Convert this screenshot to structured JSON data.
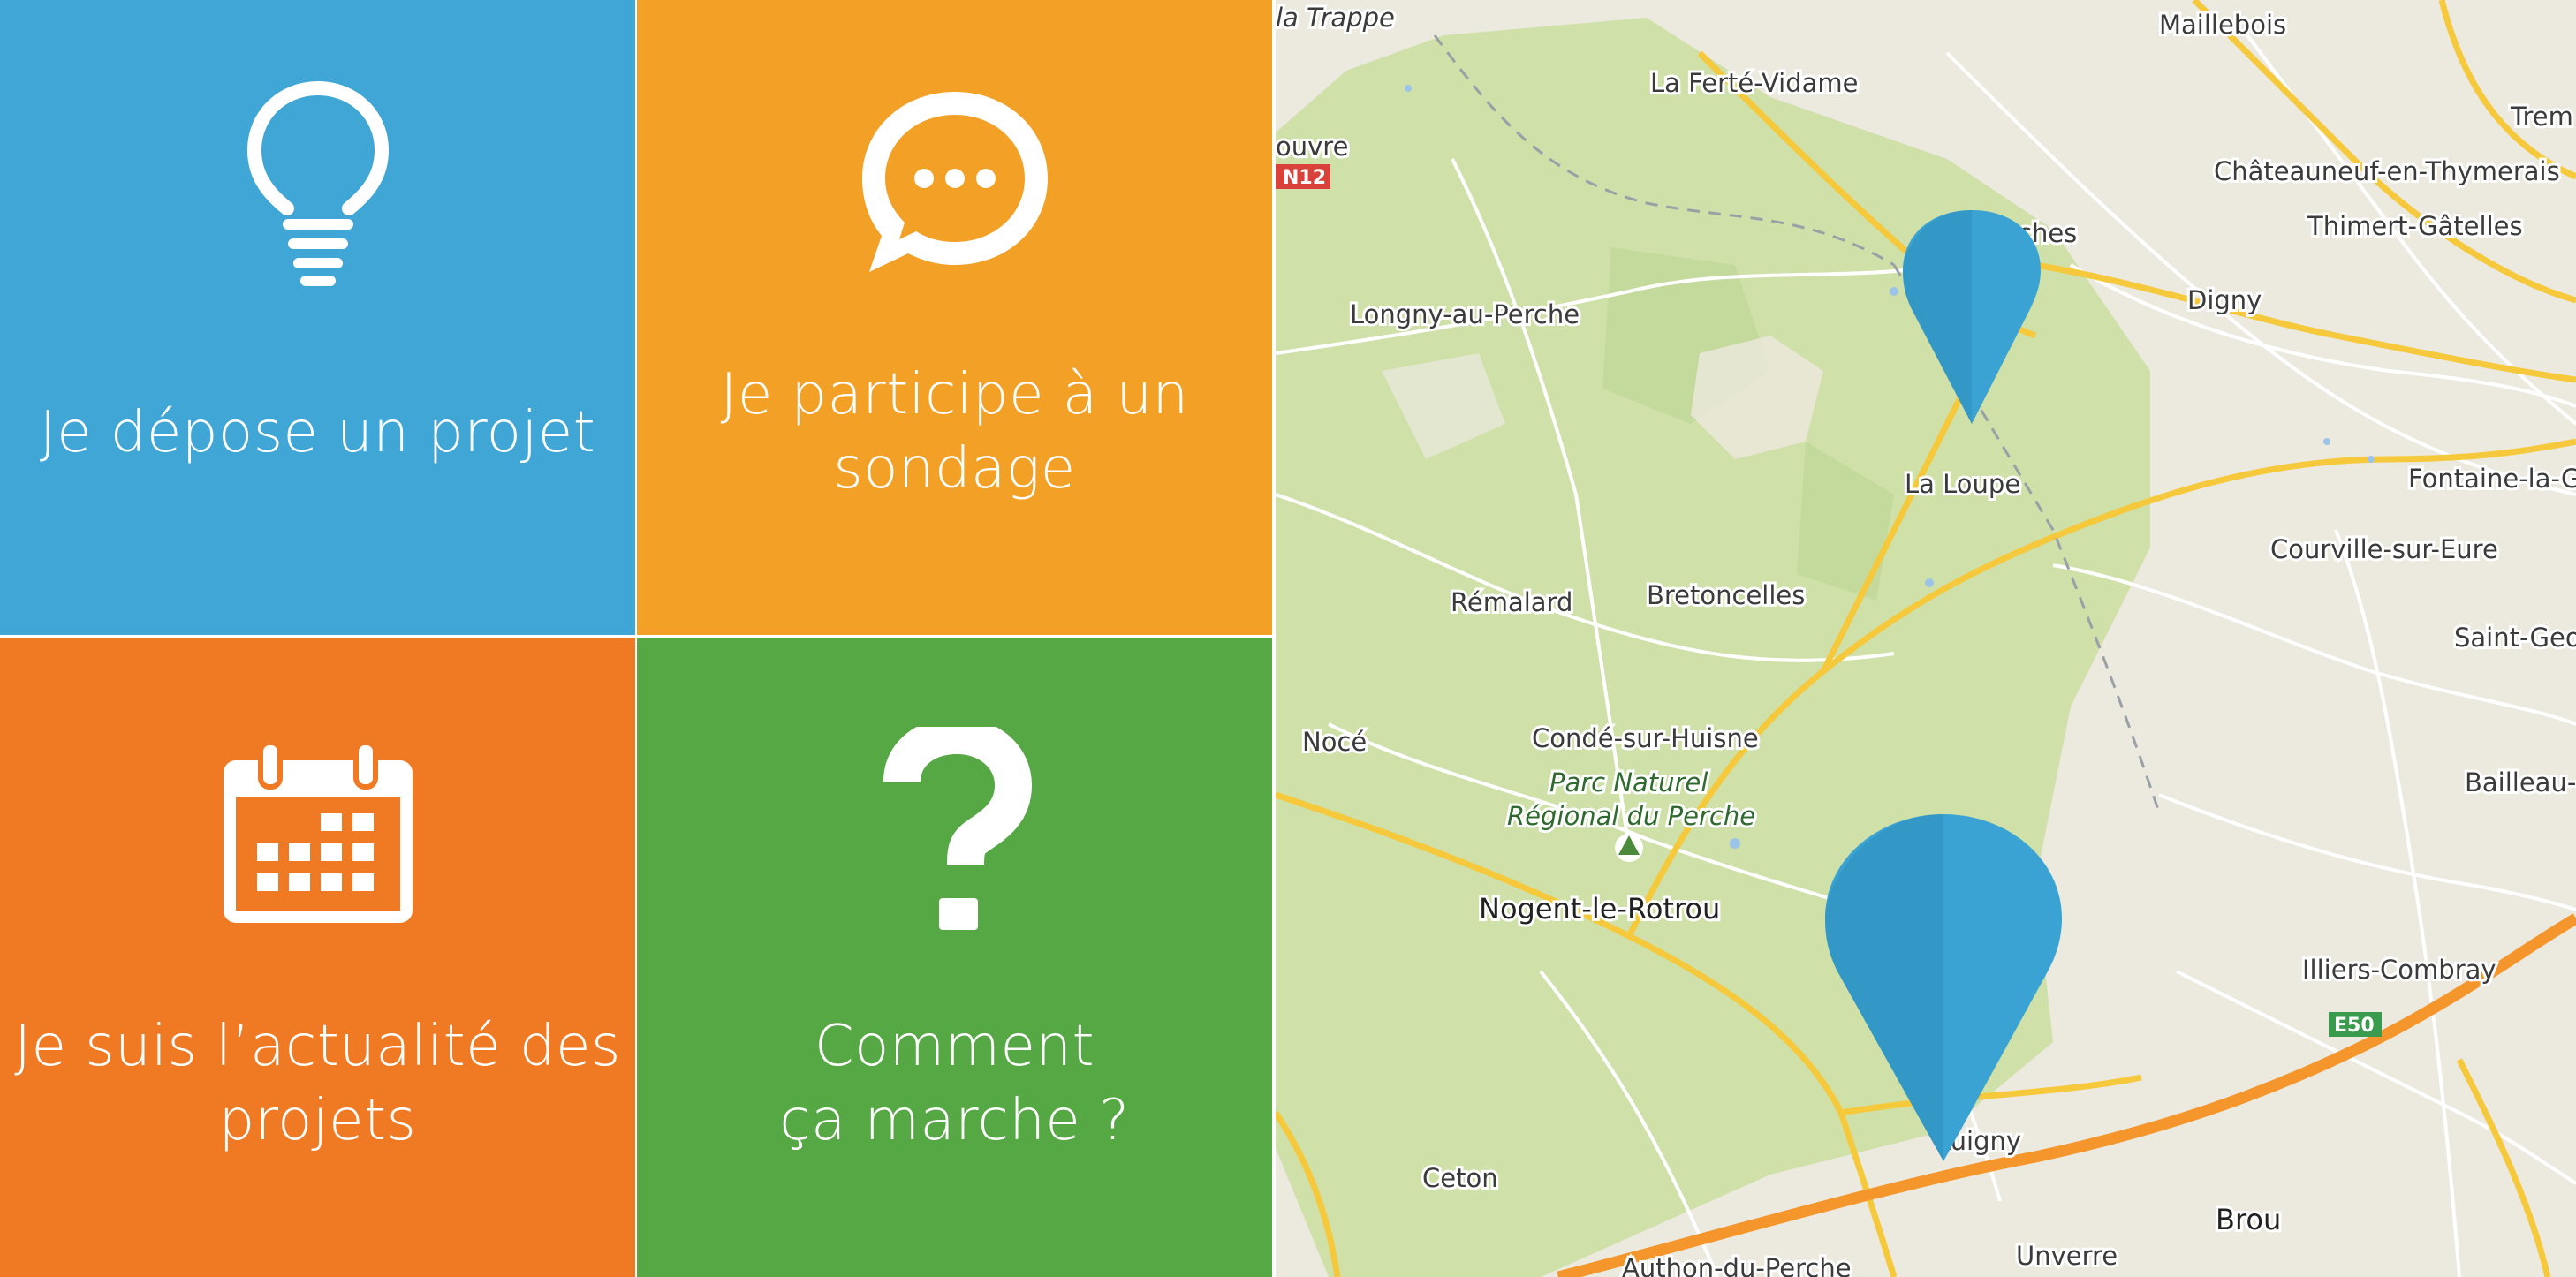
{
  "tiles": [
    {
      "label_line1": "Je dépose un projet",
      "label_line2": "",
      "icon": "lightbulb-icon",
      "color": "#3fa6d6"
    },
    {
      "label_line1": "Je participe à un",
      "label_line2": "sondage",
      "icon": "chat-bubble-icon",
      "color": "#f2a126"
    },
    {
      "label_line1": "Je suis l’actualité des",
      "label_line2": "projets",
      "icon": "calendar-icon",
      "color": "#f07a24"
    },
    {
      "label_line1": "Comment",
      "label_line2": "ça marche ?",
      "icon": "question-mark-icon",
      "color": "#56a845"
    }
  ],
  "map": {
    "park_line1": "Parc Naturel",
    "park_line2": "Régional du Perche",
    "places": {
      "la_trappe": "la Trappe",
      "maillebois": "Maillebois",
      "tremblay": "Trem",
      "la_ferte_vidame": "La Ferté-Vidame",
      "louvre": "ouvre",
      "chateauneuf": "Châteauneuf-en-Thymerais",
      "thimert": "Thimert-Gâtelles",
      "senonches": "ches",
      "longny": "Longny-au-Perche",
      "digny": "Digny",
      "la_loupe": "La Loupe",
      "fontaine": "Fontaine-la-G",
      "courville": "Courville-sur-Eure",
      "remalard": "Rémalard",
      "bretoncelles": "Bretoncelles",
      "saint_georges": "Saint-Geo",
      "noce": "Nocé",
      "conde": "Condé-sur-Huisne",
      "bailleau": "Bailleau-",
      "nogent": "Nogent-le-Rotrou",
      "illiers": "Illiers-Combray",
      "ceton": "Ceton",
      "luigny": "Luigny",
      "brou": "Brou",
      "unverre": "Unverre",
      "authon": "Authon-du-Perche"
    },
    "shields": {
      "n12": "N12",
      "e50": "E50"
    },
    "marker_color": "#3aa3d3"
  }
}
